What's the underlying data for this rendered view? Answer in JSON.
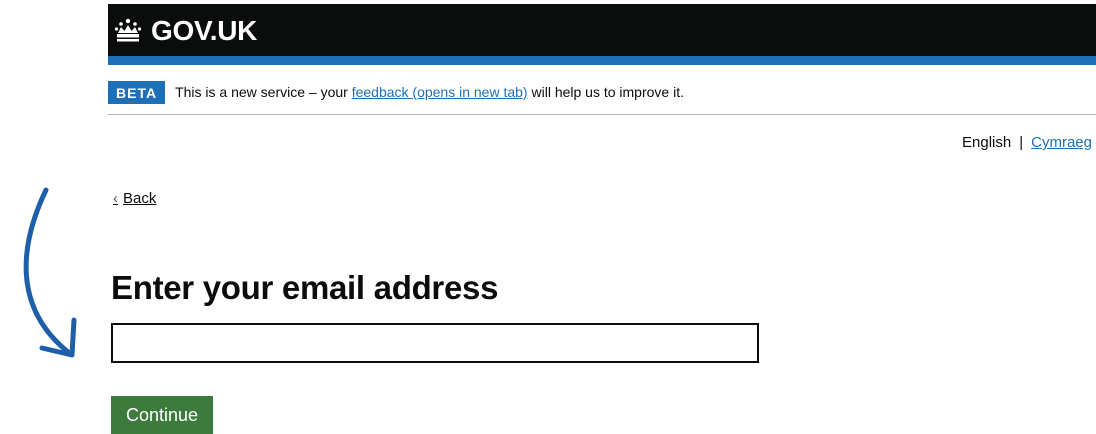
{
  "header": {
    "logo_text": "GOV.UK",
    "logo_icon": "crown-icon"
  },
  "phase_banner": {
    "tag": "BETA",
    "text_before": "This is a new service – your ",
    "link_text": "feedback (opens in new tab)",
    "text_after": " will help us to improve it."
  },
  "language": {
    "current": "English",
    "separator": "|",
    "alternate": "Cymraeg"
  },
  "back_link": {
    "label": "Back",
    "icon": "chevron-left-icon"
  },
  "form": {
    "heading": "Enter your email address",
    "email_value": "",
    "submit_label": "Continue"
  },
  "annotation": {
    "icon": "curved-arrow-icon",
    "color": "#1d5fa8"
  },
  "colors": {
    "header_bg": "#0b0c0c",
    "brand_blue": "#1d70b8",
    "button_green": "#3d7a3d"
  }
}
